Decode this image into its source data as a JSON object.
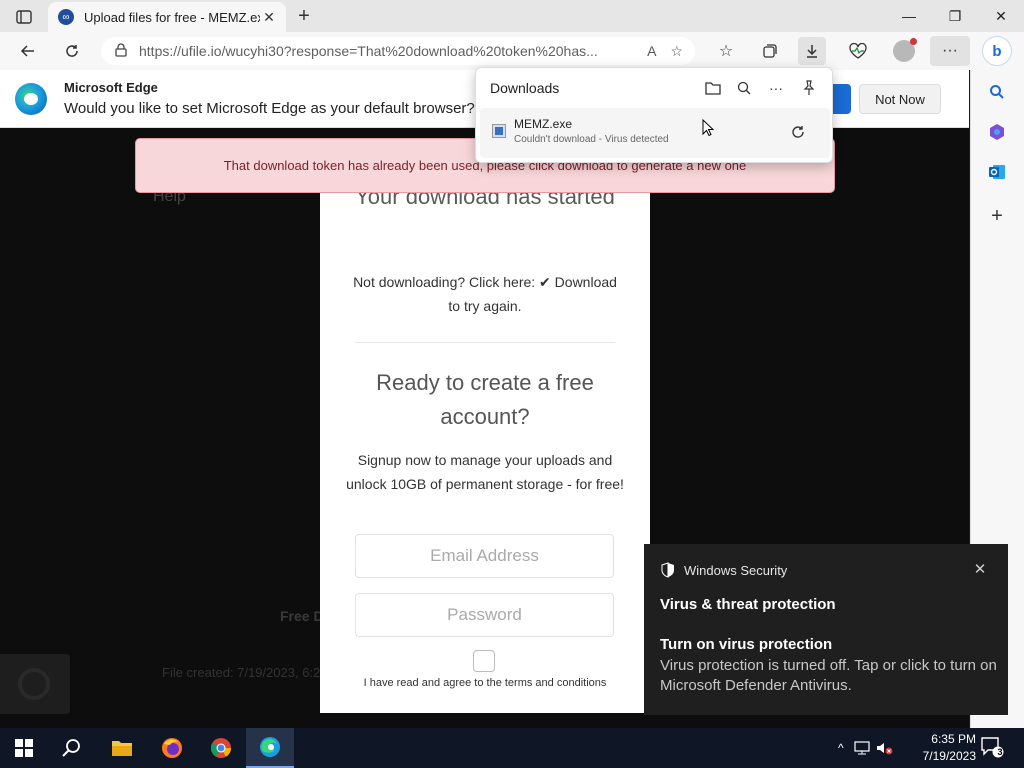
{
  "browser": {
    "tab": {
      "title": "Upload files for free - MEMZ.exe",
      "close": "✕"
    },
    "new_tab": "+",
    "window_controls": {
      "minimize": "—",
      "restore": "❐",
      "close": "✕"
    },
    "address": {
      "url": "https://ufile.io/wucyhi30?response=That%20download%20token%20has..."
    }
  },
  "infobar": {
    "title": "Microsoft Edge",
    "message": "Would you like to set Microsoft Edge as your default browser?",
    "not_now": "Not Now"
  },
  "downloads": {
    "title": "Downloads",
    "item": {
      "filename": "MEMZ.exe",
      "status": "Couldn't download - Virus detected"
    },
    "more": "···"
  },
  "page": {
    "error_banner": "That download token has already been used, please click download to generate a new one",
    "help_link": "Help",
    "card": {
      "heading": "Your download has started",
      "not_downloading": "Not downloading? Click here: ✔ Download to try again.",
      "ready_heading": "Ready to create a free account?",
      "signup_text": "Signup now to manage your uploads and unlock 10GB of permanent storage - for free!",
      "email_placeholder": "Email Address",
      "password_placeholder": "Password",
      "terms": "I have read and agree to the terms and conditions"
    },
    "free_download_partial": "Free D",
    "file_created_partial": "File created: 7/19/2023, 6:2"
  },
  "toast": {
    "app": "Windows Security",
    "heading": "Virus & threat protection",
    "sub_heading": "Turn on virus protection",
    "body": "Virus protection is turned off. Tap or click to turn on Microsoft Defender Antivirus.",
    "close": "✕"
  },
  "taskbar": {
    "time": "6:35 PM",
    "date": "7/19/2023",
    "notification_count": "3",
    "tray_chevron": "^"
  },
  "colors": {
    "edge_blue": "#1a6bd6",
    "error_bg": "#f8d7da",
    "toast_bg": "#1f1f1f",
    "taskbar_bg": "#0f1626"
  }
}
